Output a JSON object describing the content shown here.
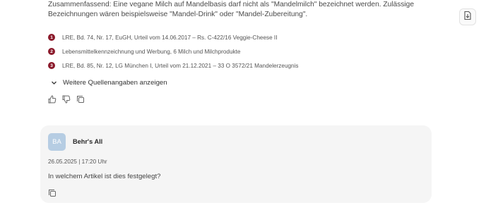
{
  "answer": {
    "summary_line1": "Zusammenfassend: Eine vegane Milch auf Mandelbasis darf nicht als \"Mandelmilch\" bezeichnet werden. Zulässige",
    "summary_line2": "Bezeichnungen wären beispielsweise \"Mandel-Drink\" oder \"Mandel-Zubereitung\"."
  },
  "sources": [
    {
      "number": "1",
      "text": "LRE, Bd. 74, Nr. 17, EuGH, Urteil vom 14.06.2017 – Rs. C-422/16 Veggie-Cheese II"
    },
    {
      "number": "2",
      "text": "Lebensmittelkennzeichnung und Werbung, 6 Milch und Milchprodukte"
    },
    {
      "number": "3",
      "text": "LRE, Bd. 85, Nr. 12, LG München I, Urteil vom 21.12.2021 – 33 O 3572/21 Mandelerzeugnis"
    }
  ],
  "more_sources_label": "Weitere Quellenangaben anzeigen",
  "icons": {
    "export": "export-document-icon",
    "thumbs_up": "thumbs-up-icon",
    "thumbs_down": "thumbs-down-icon",
    "copy": "copy-icon",
    "chevron": "chevron-down-icon"
  },
  "message": {
    "avatar_initials": "BA",
    "user_name": "Behr's All",
    "timestamp": "26.05.2025 | 17:20 Uhr",
    "text": "In welchem Artikel ist dies festgelegt?"
  },
  "colors": {
    "source_badge": "#8b1a2b",
    "avatar_bg": "#b6cde3",
    "card_bg": "#f5f5f5"
  }
}
